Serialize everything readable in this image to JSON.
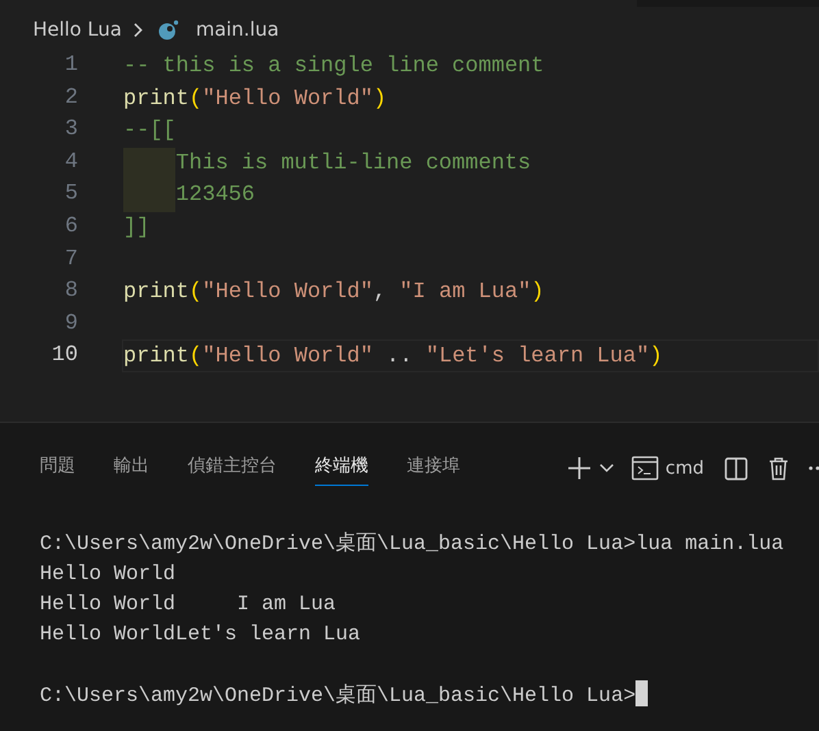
{
  "breadcrumb": {
    "folder": "Hello Lua",
    "file": "main.lua"
  },
  "editor": {
    "lines": [
      {
        "number": "1",
        "current": false,
        "indented": false,
        "tokens": [
          {
            "kind": "comment",
            "text": "-- this is a single line comment"
          }
        ]
      },
      {
        "number": "2",
        "current": false,
        "indented": false,
        "tokens": [
          {
            "kind": "func",
            "text": "print"
          },
          {
            "kind": "paren",
            "text": "("
          },
          {
            "kind": "string",
            "text": "\"Hello World\""
          },
          {
            "kind": "paren",
            "text": ")"
          }
        ]
      },
      {
        "number": "3",
        "current": false,
        "indented": false,
        "tokens": [
          {
            "kind": "comment",
            "text": "--[["
          }
        ]
      },
      {
        "number": "4",
        "current": false,
        "indented": true,
        "tokens": [
          {
            "kind": "comment",
            "text": "This is mutli-line comments"
          }
        ]
      },
      {
        "number": "5",
        "current": false,
        "indented": true,
        "tokens": [
          {
            "kind": "comment",
            "text": "123456"
          }
        ]
      },
      {
        "number": "6",
        "current": false,
        "indented": false,
        "tokens": [
          {
            "kind": "comment",
            "text": "]]"
          }
        ]
      },
      {
        "number": "7",
        "current": false,
        "indented": false
      },
      {
        "number": "8",
        "current": false,
        "indented": false,
        "tokens": [
          {
            "kind": "func",
            "text": "print"
          },
          {
            "kind": "paren",
            "text": "("
          },
          {
            "kind": "string",
            "text": "\"Hello World\""
          },
          {
            "kind": "plain",
            "text": ", "
          },
          {
            "kind": "string",
            "text": "\"I am Lua\""
          },
          {
            "kind": "paren",
            "text": ")"
          }
        ]
      },
      {
        "number": "9",
        "current": false,
        "indented": false
      },
      {
        "number": "10",
        "current": true,
        "indented": false,
        "tokens": [
          {
            "kind": "func",
            "text": "print"
          },
          {
            "kind": "paren",
            "text": "("
          },
          {
            "kind": "string",
            "text": "\"Hello World\""
          },
          {
            "kind": "plain",
            "text": " .. "
          },
          {
            "kind": "string",
            "text": "\"Let's learn Lua\""
          },
          {
            "kind": "paren",
            "text": ")"
          }
        ]
      }
    ]
  },
  "panel": {
    "tabs": [
      {
        "label": "問題",
        "selected": false
      },
      {
        "label": "輸出",
        "selected": false
      },
      {
        "label": "偵錯主控台",
        "selected": false
      },
      {
        "label": "終端機",
        "selected": true
      },
      {
        "label": "連接埠",
        "selected": false
      }
    ],
    "shell": "cmd",
    "terminal_blocks": [
      {
        "lines": [
          "C:\\Users\\amy2w\\OneDrive\\桌面\\Lua_basic\\Hello Lua>lua main.lua",
          "Hello World",
          "Hello World     I am Lua",
          "Hello WorldLet's learn Lua"
        ]
      },
      {
        "lines": [
          "C:\\Users\\amy2w\\OneDrive\\桌面\\Lua_basic\\Hello Lua>"
        ]
      }
    ]
  }
}
